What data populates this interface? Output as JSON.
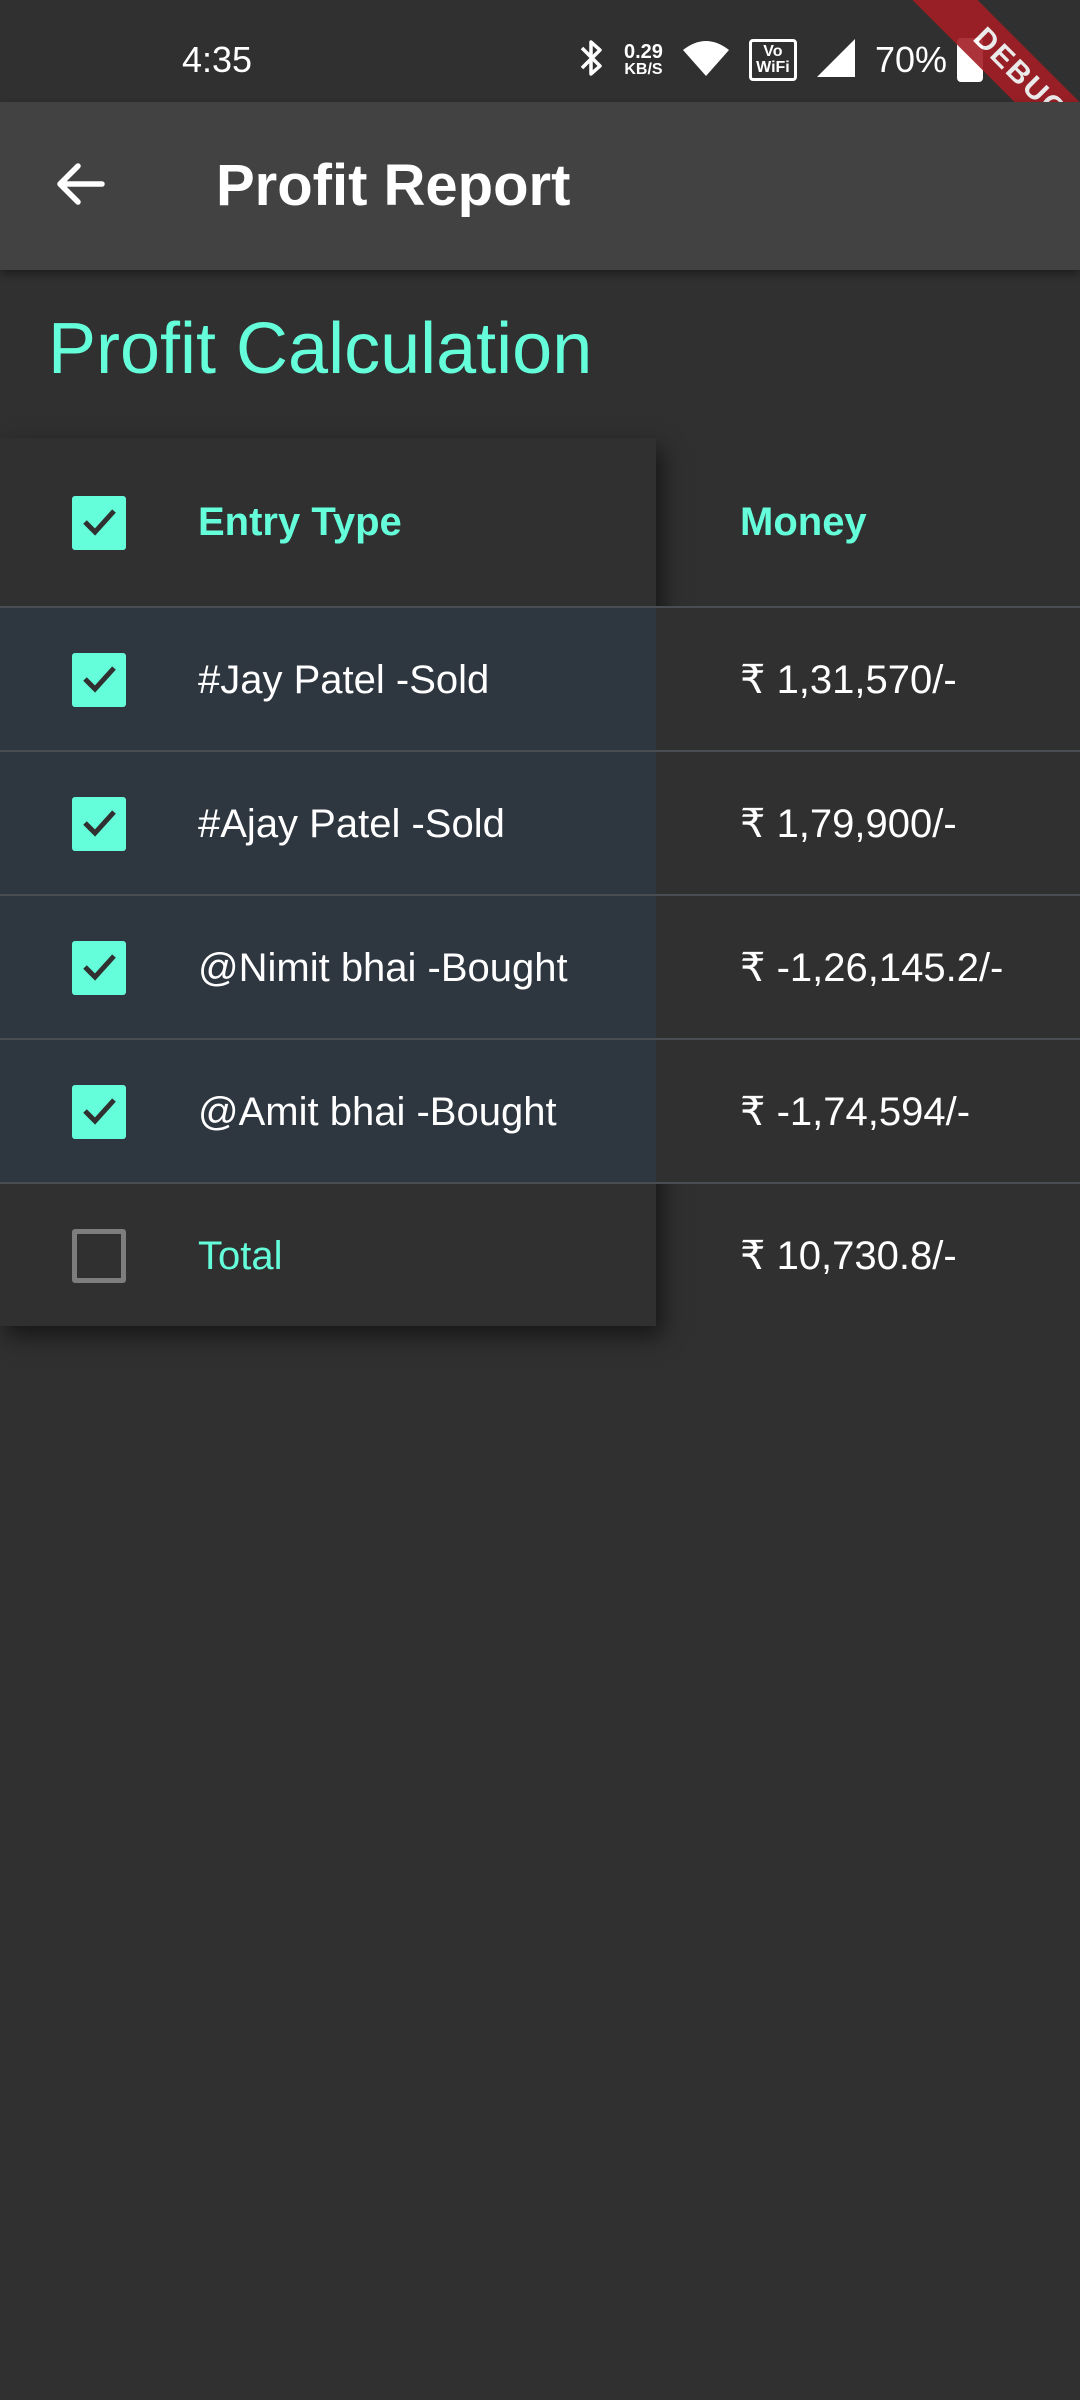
{
  "status_bar": {
    "time": "4:35",
    "net_speed_value": "0.29",
    "net_speed_unit": "KB/S",
    "volte_label": "VoLTE WiFi",
    "battery": "70%"
  },
  "debug_banner": "DEBUG",
  "app_bar": {
    "title": "Profit Report"
  },
  "section_title": "Profit Calculation",
  "table": {
    "header": {
      "entry_label": "Entry Type",
      "money_label": "Money",
      "checked": true
    },
    "rows": [
      {
        "entry": "#Jay Patel -Sold",
        "money": "₹ 1,31,570/-",
        "checked": true
      },
      {
        "entry": "#Ajay Patel -Sold",
        "money": "₹ 1,79,900/-",
        "checked": true
      },
      {
        "entry": "@Nimit bhai -Bought",
        "money": "₹ -1,26,145.2/-",
        "checked": true
      },
      {
        "entry": "@Amit bhai -Bought",
        "money": "₹ -1,74,594/-",
        "checked": true
      }
    ],
    "total": {
      "entry": "Total",
      "money": "₹ 10,730.8/-",
      "checked": false
    }
  },
  "colors": {
    "accent": "#64ffda",
    "background": "#303030",
    "app_bar": "#424242",
    "selected_row": "#2e3640",
    "debug_ribbon": "#a31e24"
  },
  "icons": {
    "back": "arrow-left-icon",
    "check": "check-icon",
    "bluetooth": "bluetooth-icon",
    "wifi": "wifi-icon",
    "signal": "signal-icon",
    "battery": "battery-icon"
  }
}
